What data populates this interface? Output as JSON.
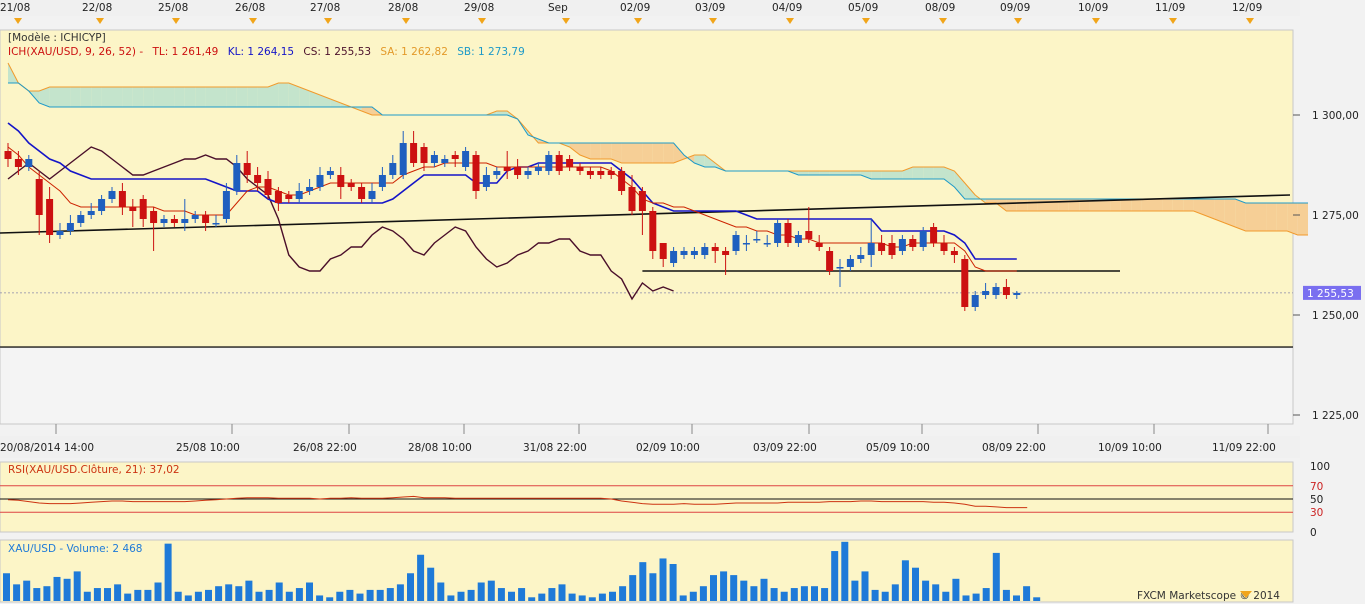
{
  "top_dates": [
    "21/08",
    "22/08",
    "25/08",
    "26/08",
    "27/08",
    "28/08",
    "29/08",
    "Sep",
    "02/09",
    "03/09",
    "04/09",
    "05/09",
    "08/09",
    "09/09",
    "10/09",
    "11/09",
    "12/09"
  ],
  "bottom_dates": [
    "20/08/2014 14:00",
    "25/08 10:00",
    "26/08 22:00",
    "28/08 10:00",
    "31/08 22:00",
    "02/09 10:00",
    "03/09 22:00",
    "05/09 10:00",
    "08/09 22:00",
    "10/09 10:00",
    "11/09 22:00"
  ],
  "template_label": "[Modèle : ICHICYP]",
  "ichimoku": {
    "name": "ICH(XAU/USD, 9, 26, 52) -",
    "tl_label": "TL: 1 261,49",
    "kl_label": "KL: 1 264,15",
    "cs_label": "CS: 1 255,53",
    "sa_label": "SA: 1 262,82",
    "sb_label": "SB: 1 273,79"
  },
  "price_axis": {
    "ticks": [
      "1 300,00",
      "1 275,00",
      "1 250,00",
      "1 225,00"
    ],
    "current": "1 255,53"
  },
  "rsi": {
    "label": "RSI(XAU/USD.Clôture, 21): 37,02",
    "ticks": [
      "100",
      "70",
      "50",
      "30",
      "0"
    ]
  },
  "volume": {
    "label": "XAU/USD - Volume: 2 468"
  },
  "footer": "FXCM Marketscope © 2014",
  "colors": {
    "bull": "#1f5fbf",
    "bear": "#cc1111",
    "tenkan": "#cc2200",
    "kijun": "#1414c8",
    "chikou": "#4a0f2a",
    "cloud_bull": "#c4e4cc",
    "cloud_bear": "#f6cf96",
    "panel": "#fcf5c7"
  },
  "chart_data": {
    "type": "candlestick",
    "ylim": [
      1218,
      1315
    ],
    "candles": [
      {
        "o": 1291,
        "c": 1289,
        "h": 1293,
        "l": 1287
      },
      {
        "o": 1289,
        "c": 1287,
        "h": 1291,
        "l": 1285
      },
      {
        "o": 1287,
        "c": 1289,
        "h": 1290,
        "l": 1286
      },
      {
        "o": 1284,
        "c": 1275,
        "h": 1286,
        "l": 1270
      },
      {
        "o": 1279,
        "c": 1270,
        "h": 1282,
        "l": 1268
      },
      {
        "o": 1270,
        "c": 1271,
        "h": 1273,
        "l": 1269
      },
      {
        "o": 1271,
        "c": 1273,
        "h": 1275,
        "l": 1270
      },
      {
        "o": 1273,
        "c": 1275,
        "h": 1276,
        "l": 1272
      },
      {
        "o": 1275,
        "c": 1276,
        "h": 1278,
        "l": 1274
      },
      {
        "o": 1276,
        "c": 1279,
        "h": 1280,
        "l": 1275
      },
      {
        "o": 1279,
        "c": 1281,
        "h": 1282,
        "l": 1278
      },
      {
        "o": 1281,
        "c": 1277,
        "h": 1283,
        "l": 1275
      },
      {
        "o": 1277,
        "c": 1276,
        "h": 1279,
        "l": 1272
      },
      {
        "o": 1279,
        "c": 1274,
        "h": 1280,
        "l": 1272
      },
      {
        "o": 1276,
        "c": 1273,
        "h": 1277,
        "l": 1266
      },
      {
        "o": 1273,
        "c": 1274,
        "h": 1275,
        "l": 1272
      },
      {
        "o": 1274,
        "c": 1273,
        "h": 1275,
        "l": 1272
      },
      {
        "o": 1273,
        "c": 1274,
        "h": 1279,
        "l": 1271
      },
      {
        "o": 1274,
        "c": 1275,
        "h": 1276,
        "l": 1273
      },
      {
        "o": 1275,
        "c": 1273,
        "h": 1276,
        "l": 1271
      },
      {
        "o": 1273,
        "c": 1273,
        "h": 1275,
        "l": 1272
      },
      {
        "o": 1274,
        "c": 1281,
        "h": 1283,
        "l": 1273
      },
      {
        "o": 1281,
        "c": 1288,
        "h": 1290,
        "l": 1280
      },
      {
        "o": 1288,
        "c": 1285,
        "h": 1291,
        "l": 1283
      },
      {
        "o": 1285,
        "c": 1283,
        "h": 1287,
        "l": 1281
      },
      {
        "o": 1284,
        "c": 1280,
        "h": 1286,
        "l": 1279
      },
      {
        "o": 1281,
        "c": 1278,
        "h": 1282,
        "l": 1276
      },
      {
        "o": 1280,
        "c": 1279,
        "h": 1281,
        "l": 1278
      },
      {
        "o": 1279,
        "c": 1281,
        "h": 1283,
        "l": 1278
      },
      {
        "o": 1281,
        "c": 1282,
        "h": 1284,
        "l": 1280
      },
      {
        "o": 1282,
        "c": 1285,
        "h": 1287,
        "l": 1281
      },
      {
        "o": 1285,
        "c": 1286,
        "h": 1287,
        "l": 1284
      },
      {
        "o": 1285,
        "c": 1282,
        "h": 1287,
        "l": 1279
      },
      {
        "o": 1283,
        "c": 1282,
        "h": 1284,
        "l": 1281
      },
      {
        "o": 1282,
        "c": 1279,
        "h": 1283,
        "l": 1278
      },
      {
        "o": 1279,
        "c": 1281,
        "h": 1283,
        "l": 1278
      },
      {
        "o": 1282,
        "c": 1285,
        "h": 1287,
        "l": 1281
      },
      {
        "o": 1285,
        "c": 1288,
        "h": 1290,
        "l": 1284
      },
      {
        "o": 1285,
        "c": 1293,
        "h": 1296,
        "l": 1284
      },
      {
        "o": 1293,
        "c": 1288,
        "h": 1296,
        "l": 1287
      },
      {
        "o": 1292,
        "c": 1288,
        "h": 1293,
        "l": 1286
      },
      {
        "o": 1288,
        "c": 1290,
        "h": 1291,
        "l": 1287
      },
      {
        "o": 1288,
        "c": 1289,
        "h": 1290,
        "l": 1287
      },
      {
        "o": 1290,
        "c": 1289,
        "h": 1291,
        "l": 1287
      },
      {
        "o": 1287,
        "c": 1291,
        "h": 1292,
        "l": 1286
      },
      {
        "o": 1290,
        "c": 1281,
        "h": 1291,
        "l": 1279
      },
      {
        "o": 1282,
        "c": 1285,
        "h": 1287,
        "l": 1281
      },
      {
        "o": 1285,
        "c": 1286,
        "h": 1287,
        "l": 1284
      },
      {
        "o": 1287,
        "c": 1286,
        "h": 1291,
        "l": 1284
      },
      {
        "o": 1287,
        "c": 1285,
        "h": 1289,
        "l": 1284
      },
      {
        "o": 1285,
        "c": 1286,
        "h": 1287,
        "l": 1284
      },
      {
        "o": 1286,
        "c": 1287,
        "h": 1288,
        "l": 1285
      },
      {
        "o": 1286,
        "c": 1290,
        "h": 1291,
        "l": 1285
      },
      {
        "o": 1290,
        "c": 1286,
        "h": 1291,
        "l": 1285
      },
      {
        "o": 1289,
        "c": 1287,
        "h": 1290,
        "l": 1286
      },
      {
        "o": 1287,
        "c": 1286,
        "h": 1288,
        "l": 1285
      },
      {
        "o": 1286,
        "c": 1285,
        "h": 1287,
        "l": 1284
      },
      {
        "o": 1286,
        "c": 1285,
        "h": 1287,
        "l": 1284
      },
      {
        "o": 1286,
        "c": 1285,
        "h": 1287,
        "l": 1284
      },
      {
        "o": 1286,
        "c": 1281,
        "h": 1287,
        "l": 1280
      },
      {
        "o": 1282,
        "c": 1276,
        "h": 1285,
        "l": 1275
      },
      {
        "o": 1281,
        "c": 1276,
        "h": 1282,
        "l": 1270
      },
      {
        "o": 1276,
        "c": 1266,
        "h": 1277,
        "l": 1264
      },
      {
        "o": 1268,
        "c": 1264,
        "h": 1268,
        "l": 1262
      },
      {
        "o": 1263,
        "c": 1266,
        "h": 1267,
        "l": 1262
      },
      {
        "o": 1265,
        "c": 1266,
        "h": 1267,
        "l": 1264
      },
      {
        "o": 1265,
        "c": 1266,
        "h": 1267,
        "l": 1264
      },
      {
        "o": 1265,
        "c": 1267,
        "h": 1268,
        "l": 1264
      },
      {
        "o": 1267,
        "c": 1266,
        "h": 1268,
        "l": 1263
      },
      {
        "o": 1266,
        "c": 1265,
        "h": 1267,
        "l": 1260
      },
      {
        "o": 1266,
        "c": 1270,
        "h": 1271,
        "l": 1265
      },
      {
        "o": 1268,
        "c": 1268,
        "h": 1270,
        "l": 1266
      },
      {
        "o": 1269,
        "c": 1269,
        "h": 1271,
        "l": 1268
      },
      {
        "o": 1268,
        "c": 1268,
        "h": 1270,
        "l": 1267
      },
      {
        "o": 1268,
        "c": 1273,
        "h": 1274,
        "l": 1267
      },
      {
        "o": 1273,
        "c": 1268,
        "h": 1274,
        "l": 1267
      },
      {
        "o": 1268,
        "c": 1270,
        "h": 1271,
        "l": 1267
      },
      {
        "o": 1271,
        "c": 1269,
        "h": 1277,
        "l": 1268
      },
      {
        "o": 1268,
        "c": 1267,
        "h": 1270,
        "l": 1266
      },
      {
        "o": 1266,
        "c": 1261,
        "h": 1267,
        "l": 1260
      },
      {
        "o": 1262,
        "c": 1262,
        "h": 1264,
        "l": 1257
      },
      {
        "o": 1262,
        "c": 1264,
        "h": 1265,
        "l": 1261
      },
      {
        "o": 1264,
        "c": 1265,
        "h": 1267,
        "l": 1263
      },
      {
        "o": 1265,
        "c": 1268,
        "h": 1274,
        "l": 1262
      },
      {
        "o": 1268,
        "c": 1266,
        "h": 1270,
        "l": 1265
      },
      {
        "o": 1268,
        "c": 1265,
        "h": 1270,
        "l": 1264
      },
      {
        "o": 1266,
        "c": 1269,
        "h": 1270,
        "l": 1265
      },
      {
        "o": 1269,
        "c": 1267,
        "h": 1270,
        "l": 1266
      },
      {
        "o": 1267,
        "c": 1271,
        "h": 1272,
        "l": 1266
      },
      {
        "o": 1272,
        "c": 1268,
        "h": 1273,
        "l": 1267
      },
      {
        "o": 1268,
        "c": 1266,
        "h": 1270,
        "l": 1265
      },
      {
        "o": 1266,
        "c": 1265,
        "h": 1267,
        "l": 1263
      },
      {
        "o": 1264,
        "c": 1252,
        "h": 1265,
        "l": 1251
      },
      {
        "o": 1252,
        "c": 1255,
        "h": 1256,
        "l": 1251
      },
      {
        "o": 1255,
        "c": 1256,
        "h": 1258,
        "l": 1254
      },
      {
        "o": 1255,
        "c": 1257,
        "h": 1258,
        "l": 1254
      },
      {
        "o": 1257,
        "c": 1255,
        "h": 1259,
        "l": 1254
      },
      {
        "o": 1255,
        "c": 1255.53,
        "h": 1256,
        "l": 1254
      }
    ],
    "tenkan": [
      1292,
      1290,
      1287,
      1285,
      1283,
      1281,
      1278,
      1277,
      1277,
      1277,
      1277,
      1277,
      1277,
      1277,
      1277,
      1276,
      1276,
      1276,
      1275,
      1275,
      1275,
      1275,
      1278,
      1281,
      1282,
      1282,
      1281,
      1280,
      1280,
      1281,
      1282,
      1283,
      1283,
      1283,
      1283,
      1283,
      1283,
      1283,
      1285,
      1286,
      1287,
      1287,
      1288,
      1288,
      1288,
      1288,
      1288,
      1287,
      1287,
      1287,
      1287,
      1287,
      1287,
      1287,
      1287,
      1287,
      1287,
      1287,
      1286,
      1284,
      1282,
      1279,
      1278,
      1278,
      1277,
      1277,
      1276,
      1275,
      1274,
      1273,
      1272,
      1272,
      1271,
      1271,
      1270,
      1270,
      1269,
      1269,
      1268,
      1268,
      1268,
      1268,
      1268,
      1268,
      1268,
      1267,
      1267,
      1268,
      1268,
      1268,
      1268,
      1268,
      1266,
      1262,
      1261,
      1261,
      1261,
      1261
    ],
    "kijun": [
      1298,
      1296,
      1293,
      1291,
      1289,
      1288,
      1286,
      1285,
      1284,
      1284,
      1284,
      1284,
      1284,
      1284,
      1284,
      1284,
      1284,
      1284,
      1284,
      1284,
      1283,
      1282,
      1281,
      1281,
      1281,
      1279,
      1278,
      1278,
      1278,
      1278,
      1278,
      1278,
      1278,
      1278,
      1278,
      1278,
      1278,
      1279,
      1281,
      1283,
      1285,
      1285,
      1285,
      1285,
      1285,
      1283,
      1283,
      1283,
      1286,
      1287,
      1287,
      1288,
      1288,
      1288,
      1288,
      1288,
      1288,
      1288,
      1288,
      1286,
      1284,
      1281,
      1278,
      1277,
      1276,
      1276,
      1276,
      1276,
      1276,
      1276,
      1276,
      1275,
      1274,
      1274,
      1274,
      1274,
      1274,
      1274,
      1274,
      1274,
      1274,
      1274,
      1274,
      1274,
      1271,
      1271,
      1271,
      1271,
      1271,
      1271,
      1271,
      1270,
      1268,
      1264,
      1264,
      1264,
      1264,
      1264
    ],
    "chikou": [
      1284,
      1286,
      1288,
      1286,
      1284,
      1286,
      1288,
      1290,
      1292,
      1291,
      1289,
      1287,
      1285,
      1285,
      1286,
      1287,
      1288,
      1289,
      1289,
      1290,
      1289,
      1289,
      1287,
      1284,
      1282,
      1280,
      1274,
      1265,
      1262,
      1261,
      1261,
      1264,
      1265,
      1267,
      1267,
      1270,
      1272,
      1271,
      1269,
      1266,
      1265,
      1268,
      1270,
      1272,
      1271,
      1267,
      1264,
      1262,
      1263,
      1265,
      1266,
      1268,
      1268,
      1269,
      1269,
      1266,
      1265,
      1265,
      1261,
      1259,
      1254,
      1258,
      1256,
      1257,
      1256
    ],
    "senkou_a": [
      1313,
      1308,
      1306,
      1306,
      1307,
      1307,
      1307,
      1307,
      1307,
      1307,
      1307,
      1307,
      1307,
      1307,
      1307,
      1307,
      1307,
      1307,
      1307,
      1307,
      1307,
      1307,
      1307,
      1307,
      1307,
      1307,
      1308,
      1308,
      1307,
      1306,
      1305,
      1304,
      1303,
      1302,
      1301,
      1300,
      1300,
      1300,
      1300,
      1300,
      1300,
      1300,
      1300,
      1300,
      1300,
      1300,
      1300,
      1301,
      1301,
      1299,
      1296,
      1293,
      1293,
      1293,
      1292,
      1290,
      1289,
      1289,
      1289,
      1288,
      1288,
      1288,
      1288,
      1288,
      1288,
      1289,
      1290,
      1290,
      1288,
      1286,
      1286,
      1286,
      1286,
      1286,
      1286,
      1286,
      1286,
      1286,
      1286,
      1286,
      1286,
      1286,
      1286,
      1286,
      1286,
      1286,
      1286,
      1287,
      1287,
      1287,
      1287,
      1286,
      1283,
      1280,
      1278,
      1278,
      1276,
      1276,
      1276,
      1276,
      1276,
      1276,
      1276,
      1276,
      1276,
      1276,
      1276,
      1276,
      1276,
      1276,
      1276,
      1276,
      1276,
      1276,
      1276,
      1275,
      1274,
      1273,
      1272,
      1271,
      1271,
      1271,
      1271,
      1271,
      1270,
      1270
    ],
    "senkou_b": [
      1308,
      1308,
      1306,
      1303,
      1302,
      1302,
      1302,
      1302,
      1302,
      1302,
      1302,
      1302,
      1302,
      1302,
      1302,
      1302,
      1302,
      1302,
      1302,
      1302,
      1302,
      1302,
      1302,
      1302,
      1302,
      1302,
      1302,
      1302,
      1302,
      1302,
      1302,
      1302,
      1302,
      1302,
      1302,
      1302,
      1300,
      1300,
      1300,
      1300,
      1300,
      1300,
      1300,
      1300,
      1300,
      1300,
      1300,
      1300,
      1300,
      1299,
      1295,
      1294,
      1293,
      1293,
      1293,
      1293,
      1293,
      1293,
      1293,
      1293,
      1293,
      1293,
      1293,
      1293,
      1293,
      1290,
      1288,
      1287,
      1287,
      1286,
      1286,
      1286,
      1286,
      1286,
      1286,
      1286,
      1285,
      1285,
      1285,
      1285,
      1285,
      1285,
      1285,
      1284,
      1284,
      1284,
      1284,
      1284,
      1284,
      1284,
      1284,
      1282,
      1279,
      1279,
      1279,
      1279,
      1279,
      1279,
      1279,
      1279,
      1279,
      1279,
      1279,
      1279,
      1279,
      1279,
      1279,
      1279,
      1279,
      1279,
      1279,
      1279,
      1279,
      1279,
      1279,
      1279,
      1279,
      1279,
      1279,
      1278,
      1278,
      1278,
      1278,
      1278,
      1278,
      1278
    ],
    "trendline_a": [
      [
        1270.5,
        0
      ],
      [
        1280,
        121
      ]
    ],
    "support_line": [
      [
        1261,
        61
      ],
      [
        1261,
        103
      ]
    ],
    "lower_line": 1242,
    "rsi_values": [
      49,
      48,
      46,
      44,
      43,
      43,
      43,
      44,
      45,
      46,
      47,
      47,
      46,
      46,
      46,
      46,
      46,
      46,
      47,
      48,
      49,
      50,
      51,
      52,
      52,
      52,
      51,
      51,
      51,
      51,
      50,
      51,
      51,
      52,
      51,
      51,
      51,
      52,
      53,
      54,
      52,
      52,
      52,
      51,
      51,
      51,
      51,
      51,
      51,
      51,
      51,
      51,
      51,
      51,
      51,
      51,
      51,
      51,
      50,
      47,
      45,
      43,
      42,
      42,
      42,
      43,
      42,
      42,
      42,
      43,
      44,
      44,
      44,
      44,
      44,
      45,
      45,
      45,
      45,
      46,
      46,
      46,
      47,
      47,
      46,
      46,
      46,
      46,
      46,
      45,
      45,
      44,
      42,
      39,
      39,
      38,
      37,
      37,
      37.02
    ],
    "volume_values": [
      15,
      9,
      11,
      7,
      8,
      13,
      12,
      16,
      5,
      7,
      7,
      9,
      4,
      6,
      6,
      10,
      31,
      5,
      3,
      5,
      6,
      8,
      9,
      8,
      11,
      5,
      6,
      10,
      5,
      7,
      10,
      3,
      2,
      5,
      6,
      4,
      6,
      6,
      7,
      9,
      15,
      25,
      18,
      10,
      3,
      5,
      6,
      10,
      11,
      7,
      5,
      7,
      2,
      4,
      7,
      9,
      4,
      3,
      2,
      4,
      5,
      8,
      14,
      21,
      15,
      23,
      20,
      3,
      5,
      8,
      14,
      16,
      14,
      11,
      8,
      12,
      7,
      5,
      7,
      8,
      8,
      7,
      27,
      32,
      11,
      16,
      6,
      5,
      9,
      22,
      18,
      11,
      9,
      5,
      12,
      3,
      4,
      7,
      26,
      6,
      3,
      8,
      2
    ]
  }
}
